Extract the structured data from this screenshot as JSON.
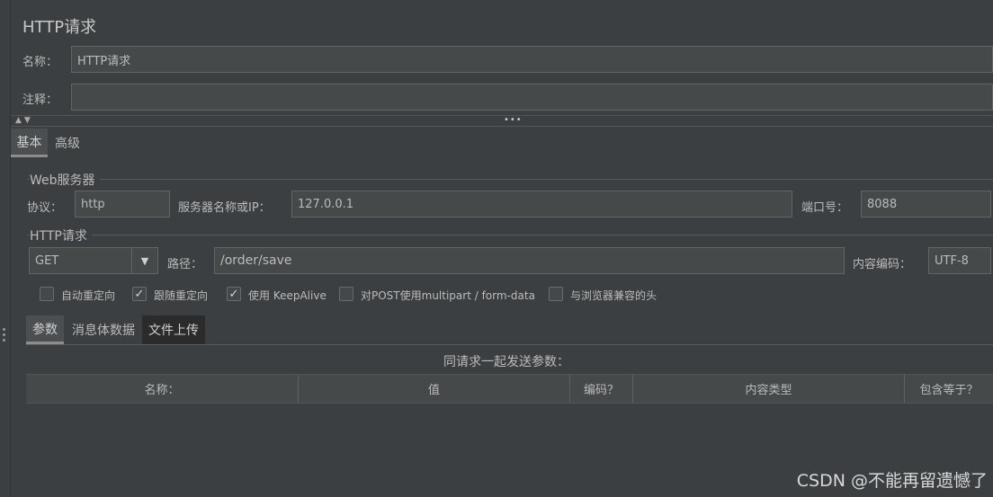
{
  "page": {
    "title": "HTTP请求"
  },
  "name_row": {
    "label": "名称：",
    "value": "HTTP请求"
  },
  "comment_row": {
    "label": "注释：",
    "value": ""
  },
  "tabs": [
    {
      "label": "基本",
      "active": true
    },
    {
      "label": "高级",
      "active": false
    }
  ],
  "web_server": {
    "section_title": "Web服务器",
    "protocol_label": "协议：",
    "protocol_value": "http",
    "server_label": "服务器名称或IP：",
    "server_value": "127.0.0.1",
    "port_label": "端口号：",
    "port_value": "8088"
  },
  "http_request": {
    "section_title": "HTTP请求",
    "method_value": "GET",
    "path_label": "路径：",
    "path_value": "/order/save",
    "encoding_label": "内容编码：",
    "encoding_value": "UTF-8"
  },
  "options": [
    {
      "label": "自动重定向",
      "checked": false
    },
    {
      "label": "跟随重定向",
      "checked": true
    },
    {
      "label": "使用 KeepAlive",
      "checked": true
    },
    {
      "label": "对POST使用multipart / form-data",
      "checked": false
    },
    {
      "label": "与浏览器兼容的头",
      "checked": false
    }
  ],
  "sub_tabs": [
    {
      "label": "参数",
      "active": true
    },
    {
      "label": "消息体数据",
      "active": false
    },
    {
      "label": "文件上传",
      "active": false
    }
  ],
  "params": {
    "caption": "同请求一起发送参数：",
    "columns": [
      "名称：",
      "值",
      "编码？",
      "内容类型",
      "包含等于？"
    ]
  },
  "watermark": "CSDN @不能再留遗憾了",
  "icons": {
    "check": "checkmark-icon",
    "dropdown": "chevron-down-icon"
  },
  "colors": {
    "background": "#3c3f41",
    "field": "#45494a",
    "text": "#bbbbbb"
  }
}
